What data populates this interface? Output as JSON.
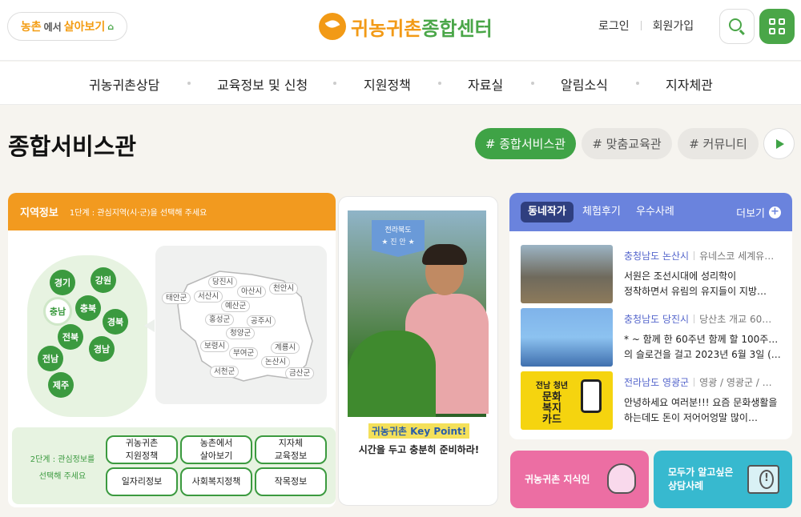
{
  "header": {
    "rural_button": {
      "part1": "농촌",
      "part2": "에서",
      "part3": "살아보기"
    },
    "logo": {
      "part1": "귀농귀촌",
      "part2": "종합센터"
    },
    "login": "로그인",
    "signup": "회원가입"
  },
  "nav": [
    "귀농귀촌상담",
    "교육정보 및 신청",
    "지원정책",
    "자료실",
    "알림소식",
    "지자체관"
  ],
  "page_title": "종합서비스관",
  "tabs": [
    {
      "label": "# 종합서비스관",
      "active": true
    },
    {
      "label": "# 맞춤교육관",
      "active": false
    },
    {
      "label": "# 커뮤니티",
      "active": false
    }
  ],
  "region": {
    "title": "지역정보",
    "step1": "1단계 : 관심지역(시·군)을 선택해 주세요",
    "provinces": [
      "경기",
      "강원",
      "충남",
      "충북",
      "경북",
      "전북",
      "경남",
      "전남",
      "제주"
    ],
    "selected": "충남",
    "cities": [
      "태안군",
      "서산시",
      "당진시",
      "아산시",
      "천안시",
      "예산군",
      "홍성군",
      "공주시",
      "청양군",
      "보령시",
      "부여군",
      "계룡시",
      "논산시",
      "서천군",
      "금산군"
    ],
    "step2_line1": "2단계 : 관심정보를",
    "step2_line2": "선택해 주세요",
    "info_buttons": [
      "귀농귀촌\n지원정책",
      "농촌에서\n살아보기",
      "지자체\n교육정보",
      "일자리정보",
      "사회복지정책",
      "작목정보"
    ]
  },
  "keypoint": {
    "place_top": "전라북도",
    "place_name": "★ 진 안 ★",
    "title": "귀농귀촌 Key Point!",
    "subtitle": "시간을 두고 충분히 준비하라!"
  },
  "community": {
    "tabs": [
      "동네작가",
      "체험후기",
      "우수사례"
    ],
    "more": "더보기",
    "items": [
      {
        "region": "충청남도 논산시",
        "sub": "유네스코 세계유…",
        "text1": "서원은 조선시대에 성리학이",
        "text2": "정착하면서 유림의 유지들이  지방…"
      },
      {
        "region": "충청남도 당진시",
        "sub": "당산초 개교 60…",
        "text1": "* ~ 함께 한 60주년 함께 할 100주년~",
        "text2": "의 슬로건을 걸고 2023년 6월 3일 (…"
      },
      {
        "region": "전라남도 영광군",
        "sub": "영광 / 영광군 / …",
        "text1": "안녕하세요 여러분!!! 요즘 문화생활을",
        "text2": "하는데도 돈이 저어어엉말 많이…"
      }
    ],
    "thumb3_lines": [
      "전남 청년",
      "문화",
      "복지",
      "카드"
    ]
  },
  "bottom_buttons": [
    {
      "label": "귀농귀촌 지식인",
      "icon": "lightbulb-icon"
    },
    {
      "label": "모두가 알고싶은\n상담사례",
      "icon": "folder-alert-icon"
    }
  ],
  "colors": {
    "green": "#3fa346",
    "orange": "#f29a1f",
    "blue": "#6a83dd",
    "pink": "#ec6ea3",
    "teal": "#37b9cf"
  }
}
